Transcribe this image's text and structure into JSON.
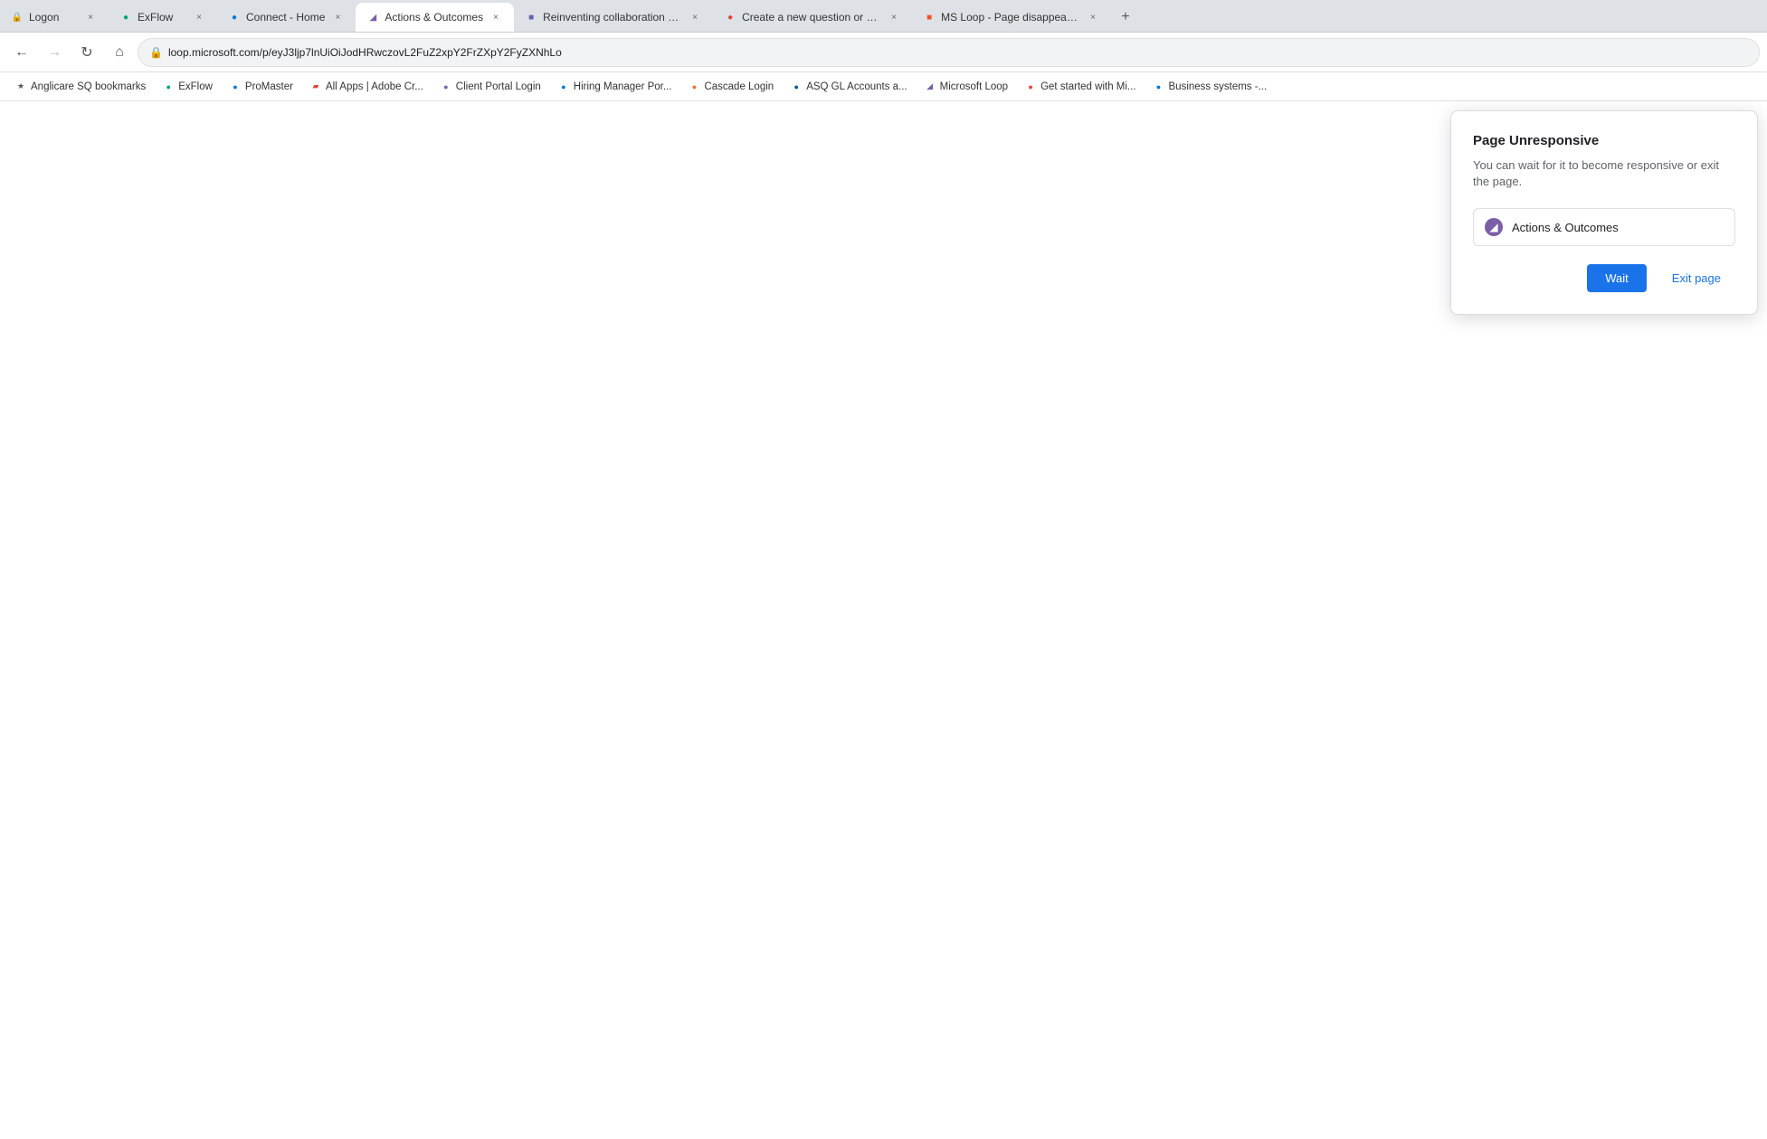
{
  "browser": {
    "url": "loop.microsoft.com/p/eyJ3ljp7lnUiOiJodHRwczovL2FuZ2xpY2FrZXpY2FyZXNhLo...",
    "url_display": "loop.microsoft.com/p/eyJ3ljp7lnUiOiJodHRwczovL2FuZ2xpY2FrZXpY2FyZXNhLo"
  },
  "tabs": [
    {
      "id": "logon",
      "label": "Logon",
      "active": false,
      "favicon_type": "logon"
    },
    {
      "id": "exflow",
      "label": "ExFlow",
      "active": false,
      "favicon_type": "exflow"
    },
    {
      "id": "connect-home",
      "label": "Connect - Home",
      "active": false,
      "favicon_type": "connect"
    },
    {
      "id": "actions-outcomes",
      "label": "Actions & Outcomes",
      "active": true,
      "favicon_type": "loop"
    },
    {
      "id": "reinventing",
      "label": "Reinventing collaboration with A...",
      "active": false,
      "favicon_type": "collab"
    },
    {
      "id": "create-question",
      "label": "Create a new question or start a...",
      "active": false,
      "favicon_type": "qa"
    },
    {
      "id": "ms-loop",
      "label": "MS Loop - Page disappeared - M...",
      "active": false,
      "favicon_type": "ms"
    }
  ],
  "nav": {
    "back_disabled": false,
    "forward_disabled": true,
    "refresh_label": "↻",
    "home_label": "⌂"
  },
  "bookmarks": [
    {
      "id": "anglicare",
      "label": "Anglicare SQ bookmarks",
      "color": "#555"
    },
    {
      "id": "exflow-bm",
      "label": "ExFlow",
      "color": "#00a86b"
    },
    {
      "id": "promaster",
      "label": "ProMaster",
      "color": "#0078d4"
    },
    {
      "id": "allapps",
      "label": "All Apps | Adobe Cr...",
      "color": "#e34234"
    },
    {
      "id": "client-portal",
      "label": "Client Portal Login",
      "color": "#7b5ea7"
    },
    {
      "id": "hiring-manager",
      "label": "Hiring Manager Por...",
      "color": "#0078d4"
    },
    {
      "id": "cascade",
      "label": "Cascade Login",
      "color": "#ff6b35"
    },
    {
      "id": "asq-gl",
      "label": "ASQ GL Accounts a...",
      "color": "#0056a2"
    },
    {
      "id": "ms-loop-bm",
      "label": "Microsoft Loop",
      "color": "#7b5ea7"
    },
    {
      "id": "get-started",
      "label": "Get started with Mi...",
      "color": "#ea4335"
    },
    {
      "id": "business-systems",
      "label": "Business systems -...",
      "color": "#0078d4"
    }
  ],
  "dialog": {
    "title": "Page Unresponsive",
    "subtitle": "You can wait for it to become responsive or exit the page.",
    "page_name": "Actions & Outcomes",
    "page_icon": "◐",
    "wait_label": "Wait",
    "exit_label": "Exit page"
  }
}
